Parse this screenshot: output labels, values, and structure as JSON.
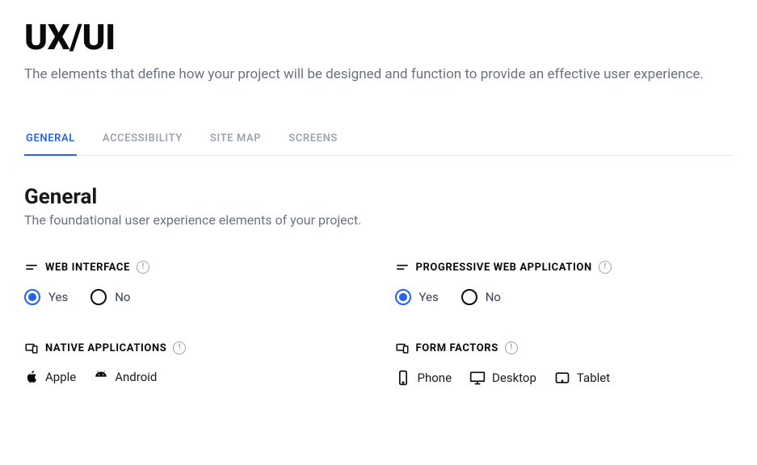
{
  "page": {
    "title": "UX/UI",
    "subtitle": "The elements that define how your project will be designed and function to provide an effective user experience."
  },
  "tabs": [
    {
      "label": "GENERAL",
      "active": true
    },
    {
      "label": "ACCESSIBILITY",
      "active": false
    },
    {
      "label": "SITE MAP",
      "active": false
    },
    {
      "label": "SCREENS",
      "active": false
    }
  ],
  "section": {
    "title": "General",
    "subtitle": "The foundational user experience elements of your project."
  },
  "fields": {
    "web_interface": {
      "label": "WEB INTERFACE",
      "options": {
        "yes": "Yes",
        "no": "No"
      },
      "selected": "yes"
    },
    "pwa": {
      "label": "PROGRESSIVE WEB APPLICATION",
      "options": {
        "yes": "Yes",
        "no": "No"
      },
      "selected": "yes"
    },
    "native_apps": {
      "label": "NATIVE APPLICATIONS",
      "items": {
        "apple": "Apple",
        "android": "Android"
      }
    },
    "form_factors": {
      "label": "FORM FACTORS",
      "items": {
        "phone": "Phone",
        "desktop": "Desktop",
        "tablet": "Tablet"
      }
    }
  }
}
